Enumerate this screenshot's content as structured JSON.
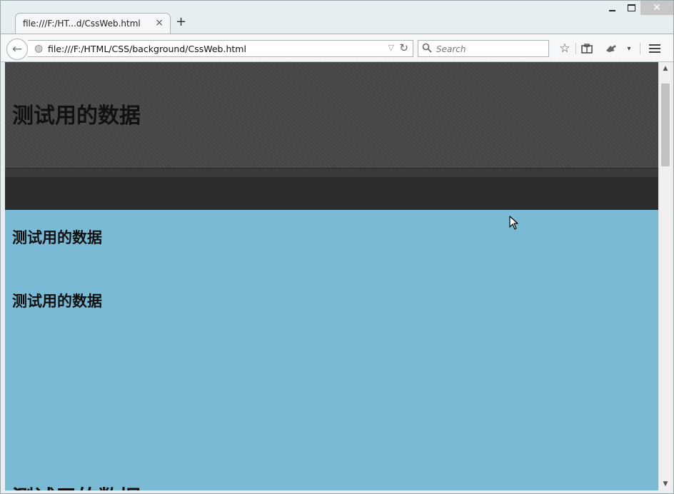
{
  "tab": {
    "title": "file:///F:/HT...d/CssWeb.html",
    "close": "×"
  },
  "new_tab": "+",
  "window_controls": {
    "close": "✕"
  },
  "nav": {
    "back": "←",
    "url": "file:///F:/HTML/CSS/background/CssWeb.html",
    "dropdown": "▽",
    "reload": "↻",
    "search_placeholder": "Search",
    "star": "☆",
    "menu_dropdown": "▾"
  },
  "content": {
    "heading_top": "测试用的数据",
    "heading_a": "测试用的数据",
    "heading_b": "测试用的数据",
    "heading_bottom": "测试用的数据"
  },
  "scrollbar": {
    "up": "▲",
    "down": "▼"
  },
  "colors": {
    "page_bg": "#7bbad5",
    "header_dark": "#454545",
    "header_bar": "#2d2d2d"
  }
}
